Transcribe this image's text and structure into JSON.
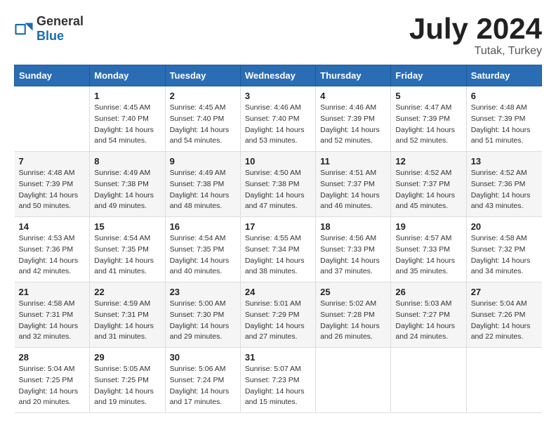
{
  "logo": {
    "general": "General",
    "blue": "Blue"
  },
  "header": {
    "month": "July 2024",
    "location": "Tutak, Turkey"
  },
  "days_of_week": [
    "Sunday",
    "Monday",
    "Tuesday",
    "Wednesday",
    "Thursday",
    "Friday",
    "Saturday"
  ],
  "weeks": [
    [
      {
        "day": "",
        "info": ""
      },
      {
        "day": "1",
        "info": "Sunrise: 4:45 AM\nSunset: 7:40 PM\nDaylight: 14 hours\nand 54 minutes."
      },
      {
        "day": "2",
        "info": "Sunrise: 4:45 AM\nSunset: 7:40 PM\nDaylight: 14 hours\nand 54 minutes."
      },
      {
        "day": "3",
        "info": "Sunrise: 4:46 AM\nSunset: 7:40 PM\nDaylight: 14 hours\nand 53 minutes."
      },
      {
        "day": "4",
        "info": "Sunrise: 4:46 AM\nSunset: 7:39 PM\nDaylight: 14 hours\nand 52 minutes."
      },
      {
        "day": "5",
        "info": "Sunrise: 4:47 AM\nSunset: 7:39 PM\nDaylight: 14 hours\nand 52 minutes."
      },
      {
        "day": "6",
        "info": "Sunrise: 4:48 AM\nSunset: 7:39 PM\nDaylight: 14 hours\nand 51 minutes."
      }
    ],
    [
      {
        "day": "7",
        "info": "Sunrise: 4:48 AM\nSunset: 7:39 PM\nDaylight: 14 hours\nand 50 minutes."
      },
      {
        "day": "8",
        "info": "Sunrise: 4:49 AM\nSunset: 7:38 PM\nDaylight: 14 hours\nand 49 minutes."
      },
      {
        "day": "9",
        "info": "Sunrise: 4:49 AM\nSunset: 7:38 PM\nDaylight: 14 hours\nand 48 minutes."
      },
      {
        "day": "10",
        "info": "Sunrise: 4:50 AM\nSunset: 7:38 PM\nDaylight: 14 hours\nand 47 minutes."
      },
      {
        "day": "11",
        "info": "Sunrise: 4:51 AM\nSunset: 7:37 PM\nDaylight: 14 hours\nand 46 minutes."
      },
      {
        "day": "12",
        "info": "Sunrise: 4:52 AM\nSunset: 7:37 PM\nDaylight: 14 hours\nand 45 minutes."
      },
      {
        "day": "13",
        "info": "Sunrise: 4:52 AM\nSunset: 7:36 PM\nDaylight: 14 hours\nand 43 minutes."
      }
    ],
    [
      {
        "day": "14",
        "info": "Sunrise: 4:53 AM\nSunset: 7:36 PM\nDaylight: 14 hours\nand 42 minutes."
      },
      {
        "day": "15",
        "info": "Sunrise: 4:54 AM\nSunset: 7:35 PM\nDaylight: 14 hours\nand 41 minutes."
      },
      {
        "day": "16",
        "info": "Sunrise: 4:54 AM\nSunset: 7:35 PM\nDaylight: 14 hours\nand 40 minutes."
      },
      {
        "day": "17",
        "info": "Sunrise: 4:55 AM\nSunset: 7:34 PM\nDaylight: 14 hours\nand 38 minutes."
      },
      {
        "day": "18",
        "info": "Sunrise: 4:56 AM\nSunset: 7:33 PM\nDaylight: 14 hours\nand 37 minutes."
      },
      {
        "day": "19",
        "info": "Sunrise: 4:57 AM\nSunset: 7:33 PM\nDaylight: 14 hours\nand 35 minutes."
      },
      {
        "day": "20",
        "info": "Sunrise: 4:58 AM\nSunset: 7:32 PM\nDaylight: 14 hours\nand 34 minutes."
      }
    ],
    [
      {
        "day": "21",
        "info": "Sunrise: 4:58 AM\nSunset: 7:31 PM\nDaylight: 14 hours\nand 32 minutes."
      },
      {
        "day": "22",
        "info": "Sunrise: 4:59 AM\nSunset: 7:31 PM\nDaylight: 14 hours\nand 31 minutes."
      },
      {
        "day": "23",
        "info": "Sunrise: 5:00 AM\nSunset: 7:30 PM\nDaylight: 14 hours\nand 29 minutes."
      },
      {
        "day": "24",
        "info": "Sunrise: 5:01 AM\nSunset: 7:29 PM\nDaylight: 14 hours\nand 27 minutes."
      },
      {
        "day": "25",
        "info": "Sunrise: 5:02 AM\nSunset: 7:28 PM\nDaylight: 14 hours\nand 26 minutes."
      },
      {
        "day": "26",
        "info": "Sunrise: 5:03 AM\nSunset: 7:27 PM\nDaylight: 14 hours\nand 24 minutes."
      },
      {
        "day": "27",
        "info": "Sunrise: 5:04 AM\nSunset: 7:26 PM\nDaylight: 14 hours\nand 22 minutes."
      }
    ],
    [
      {
        "day": "28",
        "info": "Sunrise: 5:04 AM\nSunset: 7:25 PM\nDaylight: 14 hours\nand 20 minutes."
      },
      {
        "day": "29",
        "info": "Sunrise: 5:05 AM\nSunset: 7:25 PM\nDaylight: 14 hours\nand 19 minutes."
      },
      {
        "day": "30",
        "info": "Sunrise: 5:06 AM\nSunset: 7:24 PM\nDaylight: 14 hours\nand 17 minutes."
      },
      {
        "day": "31",
        "info": "Sunrise: 5:07 AM\nSunset: 7:23 PM\nDaylight: 14 hours\nand 15 minutes."
      },
      {
        "day": "",
        "info": ""
      },
      {
        "day": "",
        "info": ""
      },
      {
        "day": "",
        "info": ""
      }
    ]
  ]
}
